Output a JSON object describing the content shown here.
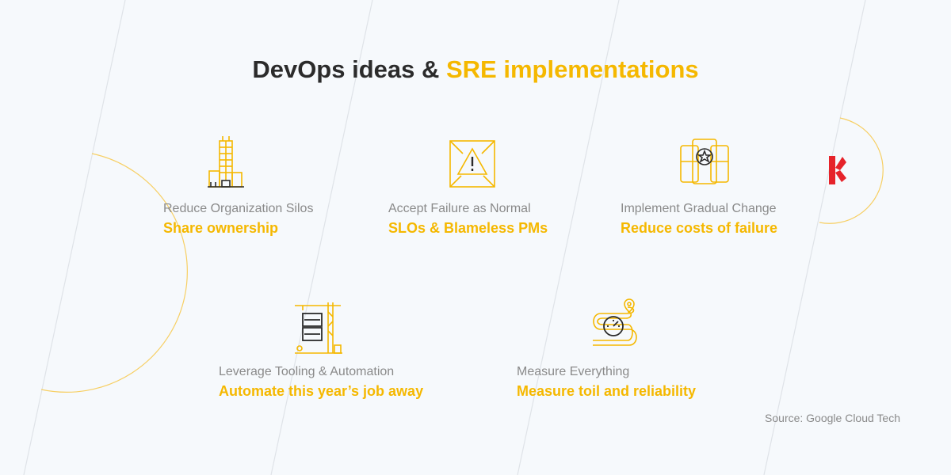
{
  "title": {
    "part1": "DevOps ideas & ",
    "part2": "SRE implementations"
  },
  "colors": {
    "accent": "#f5b800",
    "text": "#2b2b2b",
    "muted": "#8a8a8a",
    "brand": "#e6232a"
  },
  "items": [
    {
      "label": "Reduce Organization Silos",
      "value": "Share ownership",
      "icon": "office-building-icon"
    },
    {
      "label": "Accept Failure as Normal",
      "value": "SLOs & Blameless PMs",
      "icon": "warning-triangle-icon"
    },
    {
      "label": "Implement Gradual Change",
      "value": "Reduce costs of failure",
      "icon": "star-cards-icon"
    },
    {
      "label": "Leverage Tooling & Automation",
      "value": "Automate this year’s job away",
      "icon": "crane-icon"
    },
    {
      "label": "Measure Everything",
      "value": "Measure toil and reliability",
      "icon": "speedometer-road-icon"
    }
  ],
  "source": "Source: Google Cloud Tech"
}
